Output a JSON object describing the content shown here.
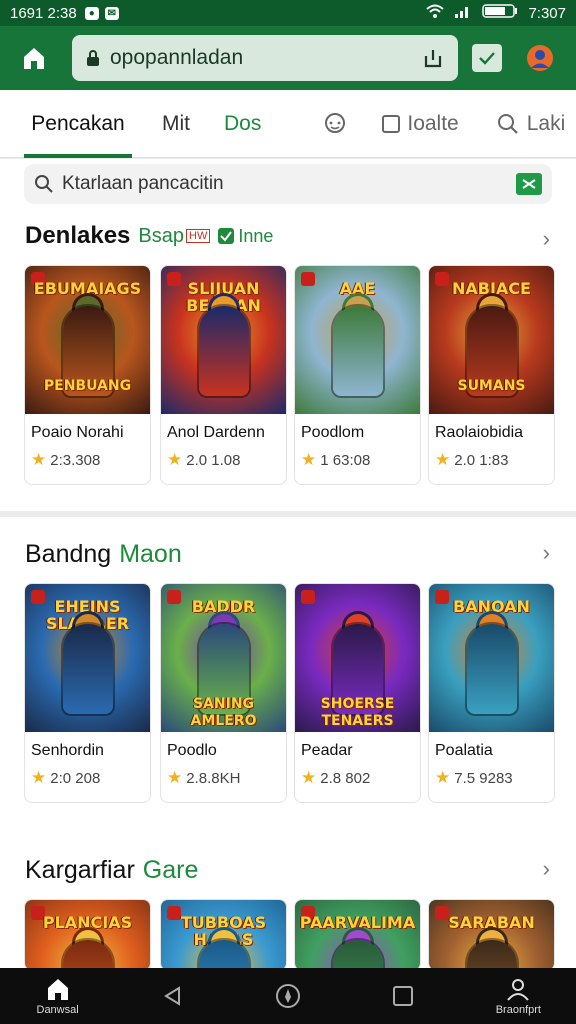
{
  "status": {
    "time_left": "1691 2:38",
    "time_right": "7:307"
  },
  "url_bar": {
    "text": "opopannladan"
  },
  "tabs": [
    {
      "label": "Pencakan",
      "color": "#111111"
    },
    {
      "label": "Mit",
      "color": "#333333"
    },
    {
      "label": "Dos",
      "color": "#1e8a3c"
    },
    {
      "label": "",
      "color": "#666"
    },
    {
      "label": "Ioalte",
      "color": "#666666"
    },
    {
      "label": "Laki",
      "color": "#666666"
    }
  ],
  "search": {
    "placeholder": "Ktarlaan pancacitin"
  },
  "sections": [
    {
      "title": "Denlakes",
      "tag1": "Bsap",
      "tag1_badge": "HW",
      "tag2": "Inne",
      "games": [
        {
          "name": "Poaio Norahi",
          "rating": "2:3.308",
          "art_title": "EBUMAIAGS",
          "art_sub": "PENBUANG",
          "colors": [
            "#3b1a12",
            "#b8561d",
            "#5a6a2a"
          ]
        },
        {
          "name": "Anol Dardenn",
          "rating": "2.0 1.08",
          "art_title": "SLIJUAN BEOBAN",
          "art_sub": "",
          "colors": [
            "#1c2a6a",
            "#c8321e",
            "#e89a2a"
          ]
        },
        {
          "name": "Poodlom",
          "rating": "1 63:08",
          "art_title": "AAE",
          "art_sub": "",
          "colors": [
            "#3d7a3a",
            "#8fb5d0",
            "#c8a050"
          ]
        },
        {
          "name": "Raolaiobidia",
          "rating": "2.0 1:83",
          "art_title": "NABIACE",
          "art_sub": "SUMANS",
          "colors": [
            "#4a1a12",
            "#b83a1e",
            "#e8a53a"
          ]
        }
      ]
    },
    {
      "title": "Bandng",
      "title_accent": "Maon",
      "games": [
        {
          "name": "Senhordin",
          "rating": "2:0 208",
          "art_title": "EHEINS SLANAER",
          "art_sub": "",
          "colors": [
            "#1a2a4a",
            "#2a6ab0",
            "#d08a2a"
          ]
        },
        {
          "name": "Poodlo",
          "rating": "2.8.8KH",
          "art_title": "BADDR",
          "art_sub": "SANING AMLERO",
          "colors": [
            "#2a4a7a",
            "#6ab04a",
            "#7a3ab0"
          ]
        },
        {
          "name": "Peadar",
          "rating": "2.8 802",
          "art_title": "",
          "art_sub": "SHOERSE TENAERS",
          "colors": [
            "#2a1a4a",
            "#7a2ac0",
            "#e0402a"
          ]
        },
        {
          "name": "Poalatia",
          "rating": "7.5 9283",
          "art_title": "BANOAN",
          "art_sub": "",
          "colors": [
            "#1a4a6a",
            "#3aa0c0",
            "#e0802a"
          ]
        }
      ]
    },
    {
      "title": "Kargarfiar",
      "title_accent": "Gare",
      "games": [
        {
          "name": "",
          "rating": "",
          "art_title": "PLANCIAS",
          "art_sub": "",
          "colors": [
            "#7a2a12",
            "#e0601e",
            "#f0c040"
          ]
        },
        {
          "name": "",
          "rating": "",
          "art_title": "TUBBOAS HAVAS",
          "art_sub": "",
          "colors": [
            "#1a5a8a",
            "#3a9ad0",
            "#f0c040"
          ]
        },
        {
          "name": "",
          "rating": "",
          "art_title": "PAARVALIMA",
          "art_sub": "",
          "colors": [
            "#2a5a3a",
            "#40a060",
            "#a04ad0"
          ]
        },
        {
          "name": "",
          "rating": "",
          "art_title": "SARABAN",
          "art_sub": "",
          "colors": [
            "#3a2a1a",
            "#a06030",
            "#f0b040"
          ]
        }
      ]
    }
  ],
  "bottom_nav": [
    {
      "label": "Danwsal",
      "icon": "home-icon"
    },
    {
      "label": "",
      "icon": "back-icon"
    },
    {
      "label": "",
      "icon": "compass-icon"
    },
    {
      "label": "",
      "icon": "square-icon"
    },
    {
      "label": "Braonfprt",
      "icon": "profile-icon"
    }
  ]
}
